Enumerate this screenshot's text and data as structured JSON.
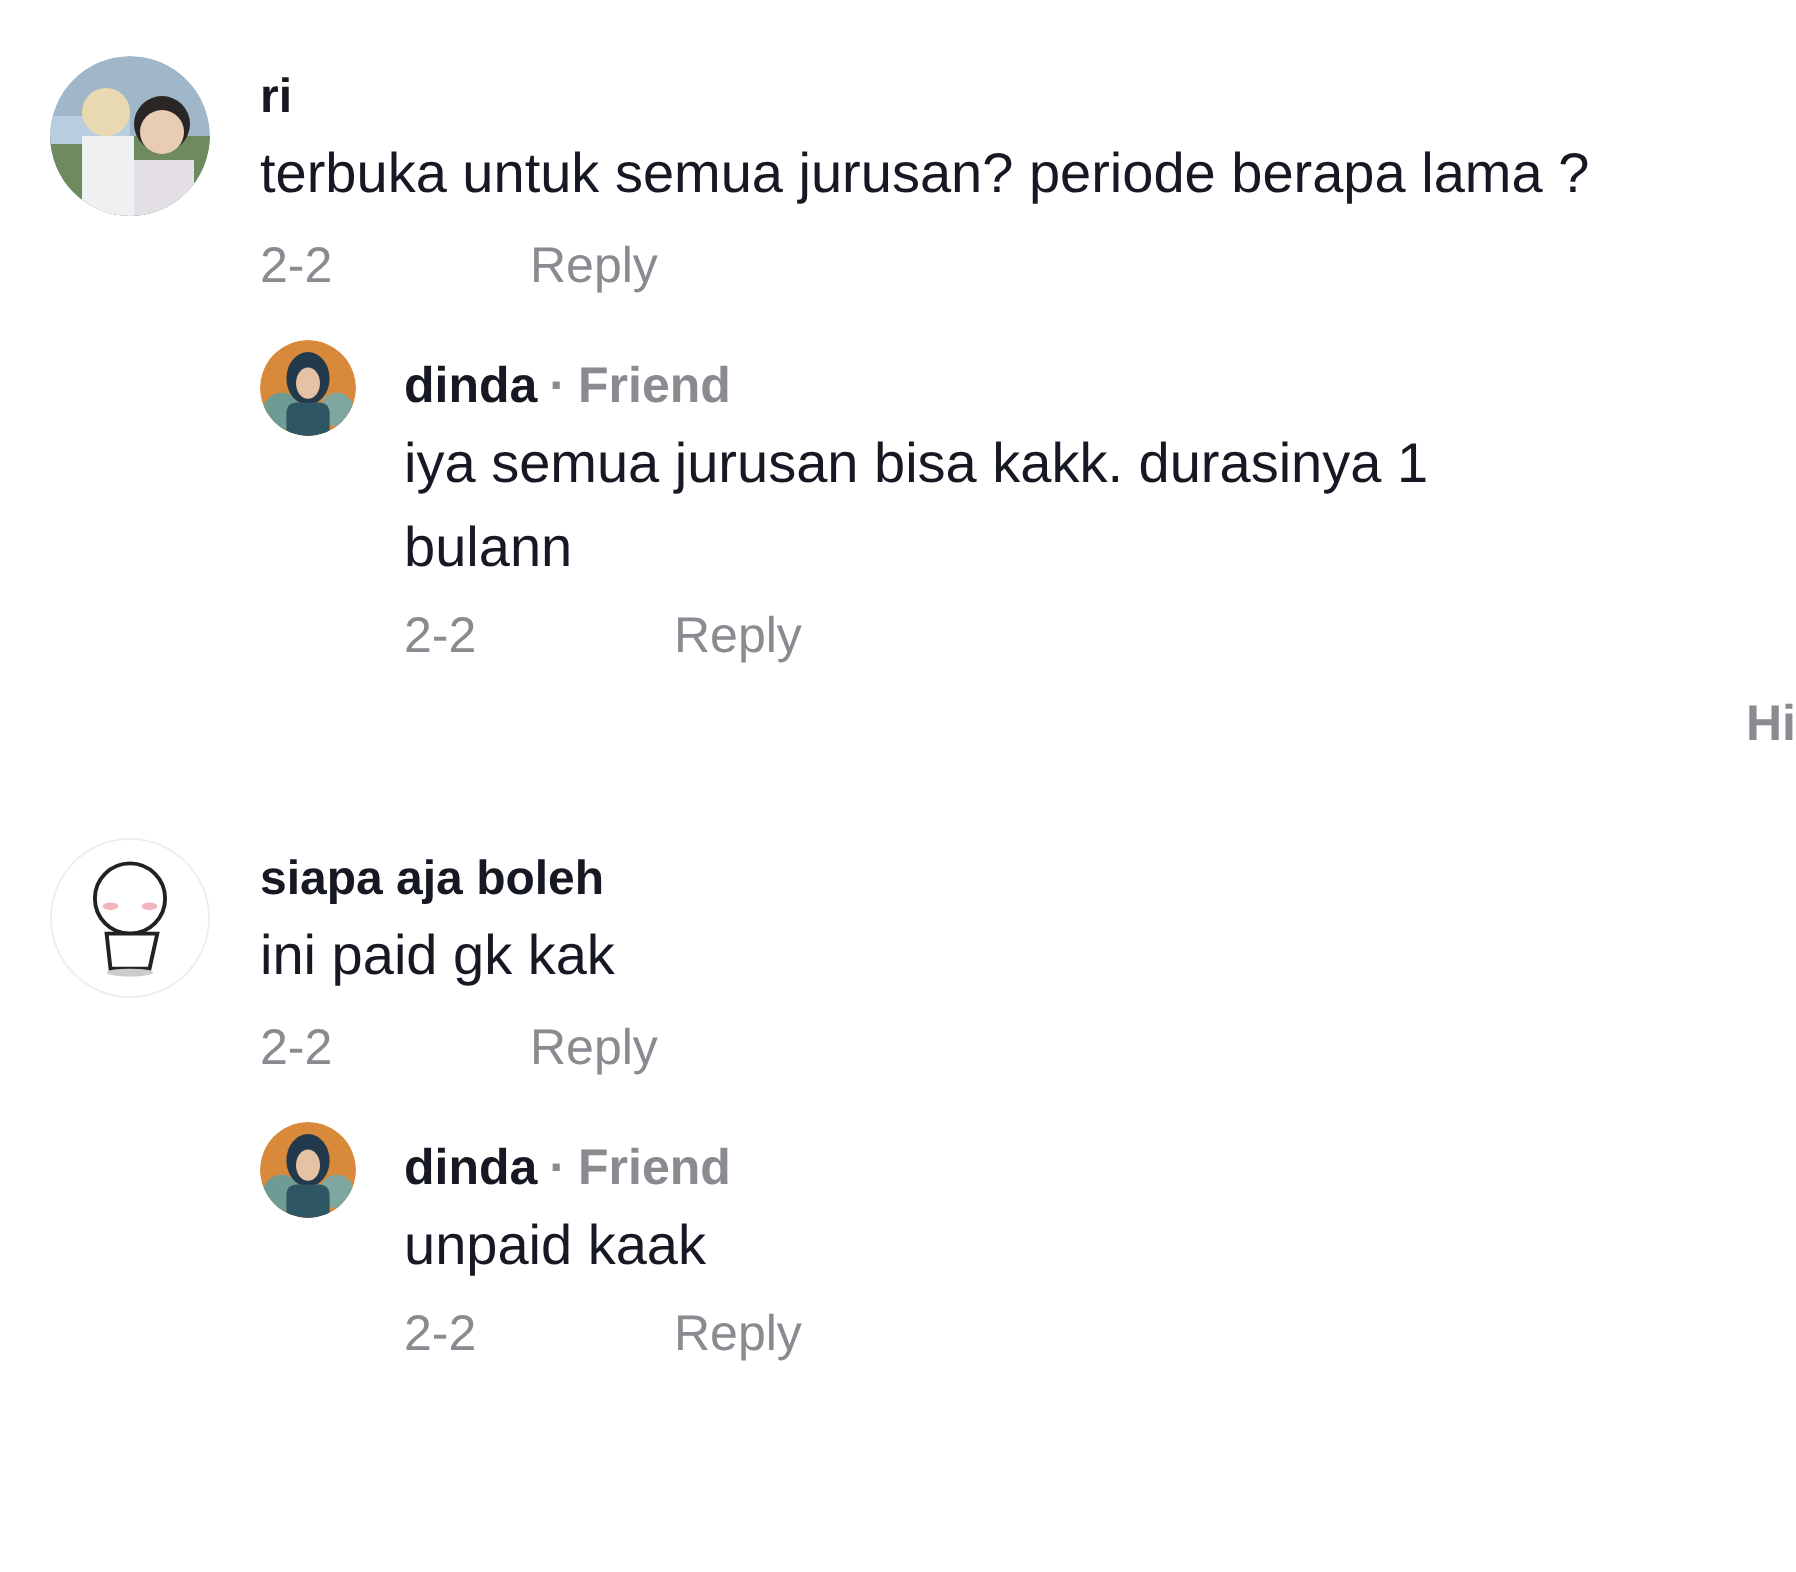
{
  "comments": [
    {
      "author": "ri",
      "avatar": {
        "kind": "picture"
      },
      "text": "terbuka untuk semua jurusan? periode berapa lama ?",
      "time": "2-2",
      "reply_label": "Reply",
      "replies": [
        {
          "author": "dinda",
          "separator": "·",
          "badge": "Friend",
          "avatar": {
            "kind": "picture"
          },
          "text": "iya semua jurusan bisa kakk. durasinya 1 bulann",
          "time": "2-2",
          "reply_label": "Reply"
        }
      ],
      "toggle_label": "Hi"
    },
    {
      "author": "siapa aja boleh",
      "avatar": {
        "kind": "picture"
      },
      "text": "ini paid gk kak",
      "time": "2-2",
      "reply_label": "Reply",
      "replies": [
        {
          "author": "dinda",
          "separator": "·",
          "badge": "Friend",
          "avatar": {
            "kind": "picture"
          },
          "text": "unpaid kaak",
          "time": "2-2",
          "reply_label": "Reply"
        }
      ]
    }
  ]
}
